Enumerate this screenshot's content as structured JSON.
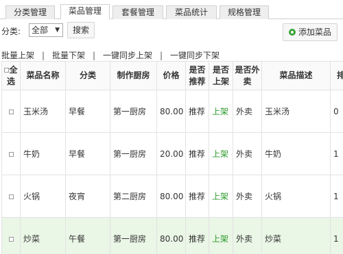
{
  "tabs": [
    {
      "label": "分类管理",
      "active": false
    },
    {
      "label": "菜品管理",
      "active": true
    },
    {
      "label": "套餐管理",
      "active": false
    },
    {
      "label": "菜品统计",
      "active": false
    },
    {
      "label": "规格管理",
      "active": false
    }
  ],
  "filter": {
    "label": "分类:",
    "selected": "全部",
    "search_label": "搜索",
    "add_label": "添加菜品"
  },
  "batch": {
    "up": "批量上架",
    "down": "批量下架",
    "sync_up": "一键同步上架",
    "sync_down": "一键同步下架",
    "separator": "|"
  },
  "table": {
    "headers": [
      "全选",
      "菜品名称",
      "分类",
      "制作厨房",
      "价格",
      "是否推荐",
      "是否上架",
      "是否外卖",
      "菜品描述",
      "排"
    ],
    "rows": [
      {
        "name": "玉米汤",
        "category": "早餐",
        "kitchen": "第一厨房",
        "price": "80.00",
        "recommend": "推荐",
        "on_shelf": "上架",
        "takeout": "外卖",
        "desc": "玉米汤",
        "sort": "0"
      },
      {
        "name": "牛奶",
        "category": "早餐",
        "kitchen": "第一厨房",
        "price": "20.00",
        "recommend": "推荐",
        "on_shelf": "上架",
        "takeout": "外卖",
        "desc": "牛奶",
        "sort": "1"
      },
      {
        "name": "火锅",
        "category": "夜宵",
        "kitchen": "第二厨房",
        "price": "80.00",
        "recommend": "推荐",
        "on_shelf": "上架",
        "takeout": "外卖",
        "desc": "火锅",
        "sort": "1"
      },
      {
        "name": "炒菜",
        "category": "午餐",
        "kitchen": "第一厨房",
        "price": "80.00",
        "recommend": "推荐",
        "on_shelf": "上架",
        "takeout": "外卖",
        "desc": "炒菜",
        "sort": "1"
      }
    ]
  },
  "colors": {
    "on_shelf": "#2a9a2a",
    "hover_row": "#eaf6e6",
    "add_icon": "#3aa33a"
  }
}
